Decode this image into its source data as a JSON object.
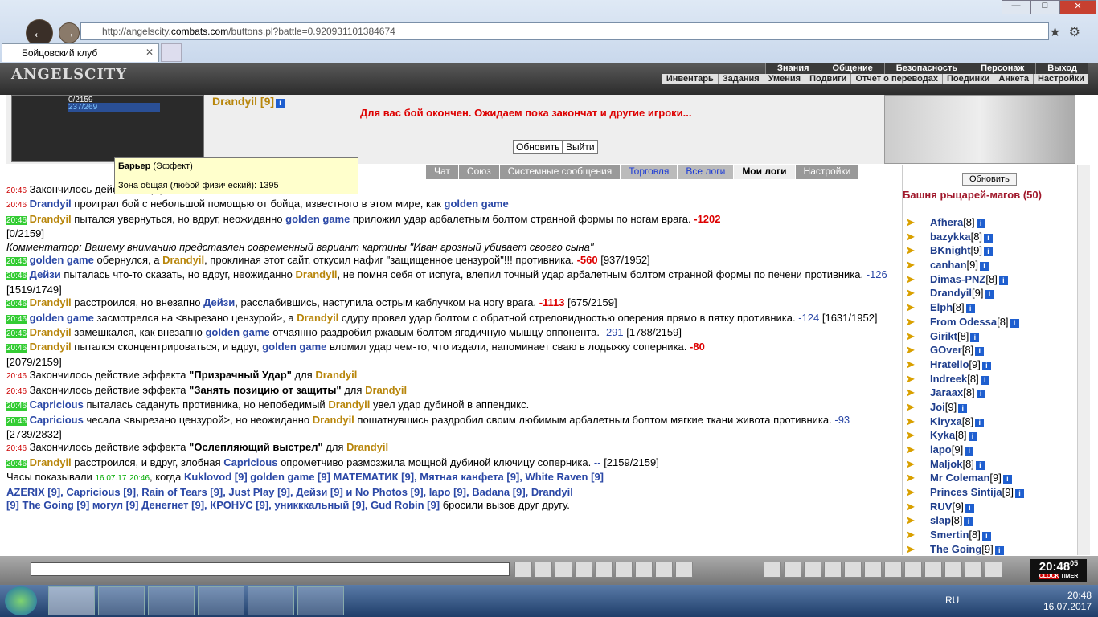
{
  "browser": {
    "url_host": "http://angelscity.",
    "url_domain": "combats.com",
    "url_path": "/buttons.pl?battle=0.920931101384674",
    "tab_title": "Бойцовский клуб"
  },
  "game": {
    "logo": "ANGELSCITY",
    "menu1": [
      "Знания",
      "Общение",
      "Безопасность",
      "Персонаж",
      "Выход"
    ],
    "menu2": [
      "Инвентарь",
      "Задания",
      "Умения",
      "Подвиги",
      "Отчет о переводах",
      "Поединки",
      "Анкета",
      "Настройки"
    ],
    "player": {
      "hp": "0/2159",
      "mp": "237/269",
      "name": "Drandyil [9]"
    },
    "battle_over": "Для вас бой окончен. Ожидаем пока закончат и другие игроки...",
    "refresh_btn": "Обновить",
    "exit_btn": "Выйти",
    "tooltip": {
      "title": "Барьер",
      "type": "(Эффект)",
      "line": "Зона общая (любой физический): 1395"
    },
    "tabs": [
      "Чат",
      "Союз",
      "Системные сообщения",
      "Торговля",
      "Все логи",
      "Мои логи",
      "Настройки"
    ],
    "right": {
      "refresh": "Обновить",
      "room": "Башня рыцарей-магов (50)",
      "players": [
        {
          "n": "Afhera",
          "l": "[8]"
        },
        {
          "n": "bazykka",
          "l": "[8]"
        },
        {
          "n": "BKnight",
          "l": "[9]"
        },
        {
          "n": "canhan",
          "l": "[9]"
        },
        {
          "n": "Dimas-PNZ",
          "l": "[8]"
        },
        {
          "n": "Drandyil",
          "l": "[9]"
        },
        {
          "n": "Elph",
          "l": "[8]"
        },
        {
          "n": "From Odessa",
          "l": "[8]"
        },
        {
          "n": "Girikt",
          "l": "[8]"
        },
        {
          "n": "GOver",
          "l": "[8]"
        },
        {
          "n": "Hratello",
          "l": "[9]"
        },
        {
          "n": "Indreek",
          "l": "[8]"
        },
        {
          "n": "Jaraax",
          "l": "[8]"
        },
        {
          "n": "Joi",
          "l": "[9]"
        },
        {
          "n": "Kiryxa",
          "l": "[8]"
        },
        {
          "n": "Kyka",
          "l": "[8]"
        },
        {
          "n": "lapo",
          "l": "[9]"
        },
        {
          "n": "Maljok",
          "l": "[8]"
        },
        {
          "n": "Mr Coleman",
          "l": "[9]"
        },
        {
          "n": "Princes Sintija",
          "l": "[9]"
        },
        {
          "n": "RUV",
          "l": "[9]"
        },
        {
          "n": "slap",
          "l": "[8]"
        },
        {
          "n": "Smertin",
          "l": "[8]"
        },
        {
          "n": "The Going",
          "l": "[9]"
        }
      ]
    },
    "clock": "20:48",
    "clock_sec": "05",
    "clock_label1": "CLOCK",
    "clock_label2": "TIMER"
  },
  "taskbar": {
    "lang": "RU",
    "time": "20:48",
    "date": "16.07.2017"
  },
  "log": {
    "l1": "Закончилось действие эффекта",
    "l2a": "Drandyil",
    "l2b": "проиграл бой с небольшой помощью от бойца, известного в этом мире, как",
    "l2c": "golden game",
    "l3a": "Drandyil",
    "l3b": "пытался увернуться, но вдруг, неожиданно",
    "l3c": "golden game",
    "l3d": "приложил удар арбалетным болтом странной формы по ногам врага.",
    "l3e": "-1202",
    "l3f": "[0/2159]",
    "l4": "Комментатор: Вашему вниманию представлен современный вариант картины \"Иван грозный убивает своего сына\"",
    "l5a": "golden game",
    "l5b": "обернулся, а",
    "l5c": "Drandyil",
    "l5d": ", проклиная этот сайт, откусил нафиг \"защищенное цензурой\"!!! противника.",
    "l5e": "-560",
    "l5f": "[937/1952]",
    "l6a": "Дейзи",
    "l6b": "пыталась что-то сказать, но вдруг, неожиданно",
    "l6c": "Drandyil",
    "l6d": ", не помня себя от испуга, влепил точный удар арбалетным болтом странной формы по печени противника.",
    "l6e": "-126",
    "l6f": "[1519/1749]",
    "l7a": "Drandyil",
    "l7b": "расстроился, но внезапно",
    "l7c": "Дейзи",
    "l7d": ", расслабившись, наступила острым каблучком на ногу врага.",
    "l7e": "-1113",
    "l7f": "[675/2159]",
    "l8a": "golden game",
    "l8b": "засмотрелся на <вырезано цензурой>, а",
    "l8c": "Drandyil",
    "l8d": "сдуру провел удар болтом с обратной стреловидностью оперения прямо в пятку противника.",
    "l8e": "-124",
    "l8f": "[1631/1952]",
    "l9a": "Drandyil",
    "l9b": "замешкался, как внезапно",
    "l9c": "golden game",
    "l9d": "отчаянно раздробил ржавым болтом ягодичную мышцу оппонента.",
    "l9e": "-291",
    "l9f": "[1788/2159]",
    "l10a": "Drandyil",
    "l10b": "пытался сконцентрироваться, и вдруг,",
    "l10c": "golden game",
    "l10d": "вломил удар чем-то, что издали, напоминает сваю в лодыжку соперника.",
    "l10e": "-80",
    "l10f": "[2079/2159]",
    "l11a": "Закончилось действие эффекта",
    "l11b": "\"Призрачный Удар\"",
    "l11c": "для",
    "l11d": "Drandyil",
    "l12a": "Закончилось действие эффекта",
    "l12b": "\"Занять позицию от защиты\"",
    "l12c": "для",
    "l12d": "Drandyil",
    "l13a": "Capricious",
    "l13b": "пыталась садануть противника, но непобедимый",
    "l13c": "Drandyil",
    "l13d": "увел удар дубиной в аппендикс.",
    "l14a": "Capricious",
    "l14b": "чесала <вырезано цензурой>, но неожиданно",
    "l14c": "Drandyil",
    "l14d": "пошатнувшись раздробил своим любимым арбалетным болтом мягкие ткани живота противника.",
    "l14e": "-93",
    "l14f": "[2739/2832]",
    "l15a": "Закончилось действие эффекта",
    "l15b": "\"Ослепляющий выстрел\"",
    "l15c": "для",
    "l15d": "Drandyil",
    "l16a": "Drandyil",
    "l16b": "расстроился, и вдруг, злобная",
    "l16c": "Capricious",
    "l16d": "опрометчиво размозжила мощной дубиной ключицу соперника.",
    "l16e": "--",
    "l16f": "[2159/2159]",
    "l17a": "Часы показывали",
    "l17b": "16.07.17",
    "l17c": "20:46",
    "l17d": ", когда",
    "l17names": "Kuklovod [9]  golden game [9]  МАТЕМАТИК [9], Мятная канфета [9], White Raven [9]",
    "l18names": "AZERIX [9], Capricious [9],  Rain of Tears [9],  Just Play [9],  Дейзи [9] и No Photos [9], lapo [9],  Badana [9],  Drandyil",
    "l19names": "[9]  The Going [9]  могул [9]  Денегнет [9], КРОНУС [9], уникккальный [9], Gud Robin [9]",
    "l19end": "бросили вызов друг другу.",
    "time": "20:46"
  }
}
